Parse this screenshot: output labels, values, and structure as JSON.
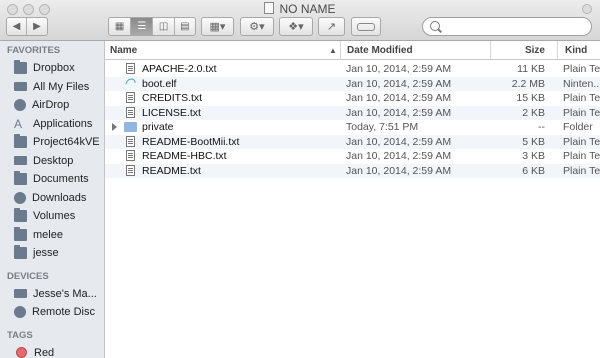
{
  "window": {
    "title": "NO NAME"
  },
  "toolbar": {
    "back_icon": "chevron-left-icon",
    "forward_icon": "chevron-right-icon",
    "view_modes": [
      "icon-view",
      "list-view",
      "column-view",
      "cover-flow-view"
    ],
    "selected_view": "list-view",
    "arrange_icon": "arrange-grid-icon",
    "action_icon": "gear-icon",
    "dropbox_icon": "dropbox-icon",
    "share_icon": "share-icon",
    "tag_icon": "tag-icon",
    "search_placeholder": ""
  },
  "sidebar": {
    "favorites_heading": "FAVORITES",
    "favorites": [
      {
        "label": "Dropbox",
        "icon": "dropbox-icon"
      },
      {
        "label": "All My Files",
        "icon": "all-files-icon"
      },
      {
        "label": "AirDrop",
        "icon": "airdrop-icon"
      },
      {
        "label": "Applications",
        "icon": "applications-icon"
      },
      {
        "label": "Project64kVE",
        "icon": "folder-icon"
      },
      {
        "label": "Desktop",
        "icon": "desktop-icon"
      },
      {
        "label": "Documents",
        "icon": "documents-icon"
      },
      {
        "label": "Downloads",
        "icon": "downloads-icon"
      },
      {
        "label": "Volumes",
        "icon": "folder-icon"
      },
      {
        "label": "melee",
        "icon": "folder-icon"
      },
      {
        "label": "jesse",
        "icon": "home-icon"
      }
    ],
    "devices_heading": "DEVICES",
    "devices": [
      {
        "label": "Jesse's Ma...",
        "icon": "computer-icon"
      },
      {
        "label": "Remote Disc",
        "icon": "remote-disc-icon"
      }
    ],
    "tags_heading": "TAGS",
    "tags": [
      {
        "label": "Red",
        "color": "#e26a6a"
      }
    ]
  },
  "columns": {
    "name": "Name",
    "date": "Date Modified",
    "size": "Size",
    "kind": "Kind"
  },
  "files": [
    {
      "name": "APACHE-2.0.txt",
      "date": "Jan 10, 2014, 2:59 AM",
      "size": "11 KB",
      "kind": "Plain Tex",
      "icon": "text-file-icon"
    },
    {
      "name": "boot.elf",
      "date": "Jan 10, 2014, 2:59 AM",
      "size": "2.2 MB",
      "kind": "Ninten...",
      "icon": "elf-file-icon"
    },
    {
      "name": "CREDITS.txt",
      "date": "Jan 10, 2014, 2:59 AM",
      "size": "15 KB",
      "kind": "Plain Tex",
      "icon": "text-file-icon"
    },
    {
      "name": "LICENSE.txt",
      "date": "Jan 10, 2014, 2:59 AM",
      "size": "2 KB",
      "kind": "Plain Tex",
      "icon": "text-file-icon"
    },
    {
      "name": "private",
      "date": "Today, 7:51 PM",
      "size": "--",
      "kind": "Folder",
      "icon": "folder-icon"
    },
    {
      "name": "README-BootMii.txt",
      "date": "Jan 10, 2014, 2:59 AM",
      "size": "5 KB",
      "kind": "Plain Tex",
      "icon": "text-file-icon"
    },
    {
      "name": "README-HBC.txt",
      "date": "Jan 10, 2014, 2:59 AM",
      "size": "3 KB",
      "kind": "Plain Tex",
      "icon": "text-file-icon"
    },
    {
      "name": "README.txt",
      "date": "Jan 10, 2014, 2:59 AM",
      "size": "6 KB",
      "kind": "Plain Tex",
      "icon": "text-file-icon"
    }
  ]
}
